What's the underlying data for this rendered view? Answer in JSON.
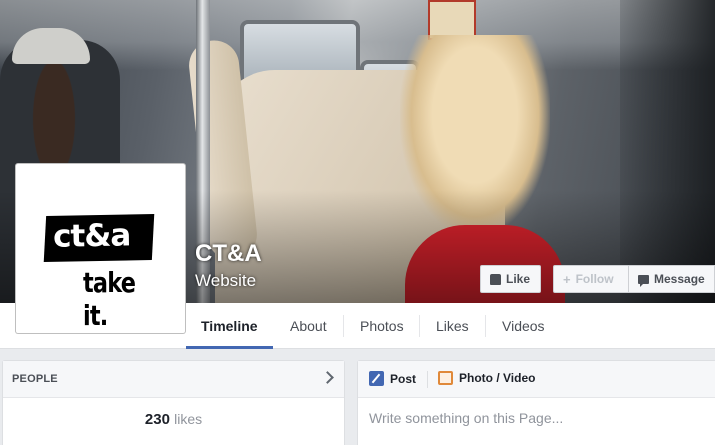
{
  "page": {
    "name": "CT&A",
    "category": "Website",
    "logo_text": "ct&a",
    "logo_tagline": "take it."
  },
  "actions": {
    "like": "Like",
    "follow": "Follow",
    "message": "Message"
  },
  "nav": {
    "tabs": [
      {
        "label": "Timeline",
        "active": true
      },
      {
        "label": "About"
      },
      {
        "label": "Photos"
      },
      {
        "label": "Likes"
      },
      {
        "label": "Videos"
      }
    ]
  },
  "people": {
    "title": "PEOPLE",
    "likes_count": "230",
    "likes_word": "likes"
  },
  "composer": {
    "post_label": "Post",
    "photo_label": "Photo / Video",
    "placeholder": "Write something on this Page..."
  },
  "colors": {
    "accent": "#4267b2",
    "background": "#e9ebee",
    "photo_icon": "#e0893a"
  }
}
